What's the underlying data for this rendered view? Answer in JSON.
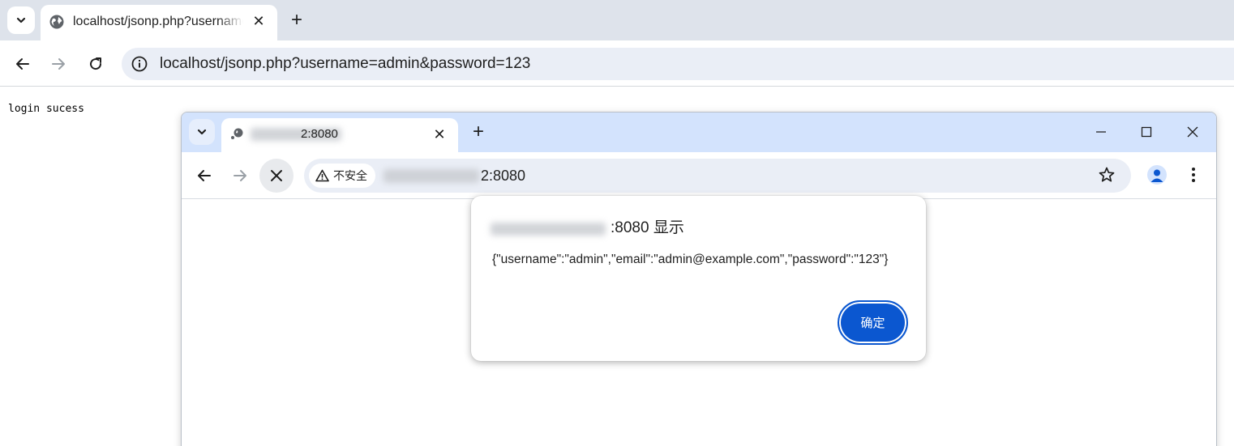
{
  "back_browser": {
    "tab_title": "localhost/jsonp.php?username=admin&password=123",
    "url": "localhost/jsonp.php?username=admin&password=123",
    "page_text": "login sucess",
    "new_tab_symbol": "+",
    "close_symbol": "✕"
  },
  "front_browser": {
    "tab_title_suffix": "2:8080",
    "url_suffix": "2:8080",
    "security_label": "不安全",
    "new_tab_symbol": "+",
    "close_symbol": "✕"
  },
  "dialog": {
    "title_suffix": ":8080 显示",
    "message": "{\"username\":\"admin\",\"email\":\"admin@example.com\",\"password\":\"123\"}",
    "ok_label": "确定"
  },
  "colors": {
    "back_tabstrip": "#dee3eb",
    "front_tabstrip": "#d3e3fd",
    "omnibox": "#eaeef6",
    "accent_button": "#0b57d0"
  },
  "icons": [
    "tab-search-icon",
    "globe-icon",
    "close-icon",
    "plus-icon",
    "back-arrow-icon",
    "forward-arrow-icon",
    "reload-icon",
    "info-icon",
    "stop-icon",
    "warning-icon",
    "star-icon",
    "profile-icon",
    "more-menu-icon",
    "minimize-icon",
    "maximize-icon",
    "window-close-icon"
  ]
}
